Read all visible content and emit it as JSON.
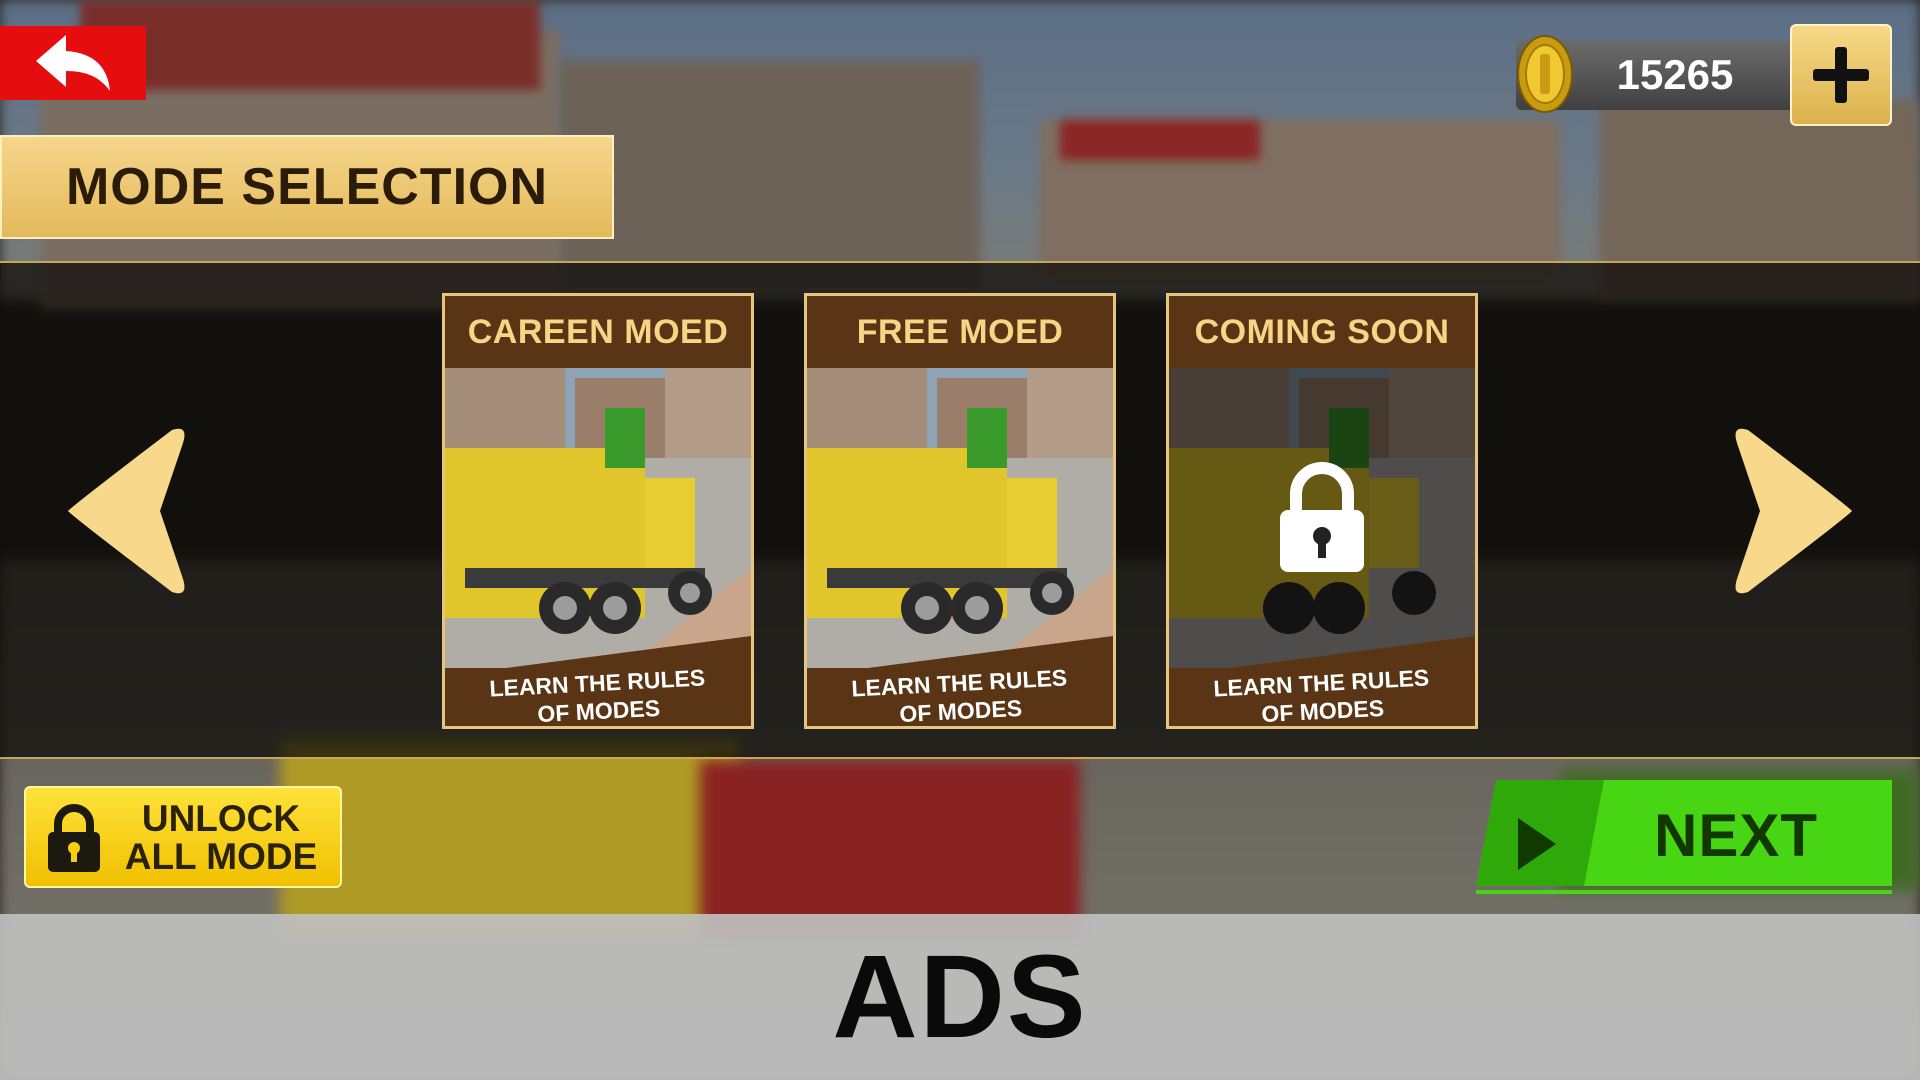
{
  "header": {
    "back_icon": "undo-arrow-icon",
    "coins": "15265",
    "coin_icon": "gold-coin-icon",
    "add_icon": "plus-icon",
    "title": "MODE SELECTION"
  },
  "modes": [
    {
      "title": "CAREEN MOED",
      "footer": "LEARN THE RULES\nOF MODES",
      "locked": false
    },
    {
      "title": "FREE MOED",
      "footer": "LEARN THE RULES\nOF MODES",
      "locked": false
    },
    {
      "title": "COMING SOON",
      "footer": "LEARN THE RULES\nOF MODES",
      "locked": true
    }
  ],
  "navigation": {
    "prev_icon": "left-arrow-icon",
    "next_icon": "right-arrow-icon"
  },
  "actions": {
    "unlock_label": "UNLOCK\nALL MODE",
    "unlock_icon": "padlock-icon",
    "next_label": "NEXT",
    "next_icon": "play-icon"
  },
  "ads": {
    "label": "ADS"
  },
  "colors": {
    "gold": "#e8c57e",
    "card_brown": "#5a3515",
    "back_red": "#e50d0d",
    "next_green": "#3fd00e",
    "unlock_yellow": "#f5cf10"
  }
}
